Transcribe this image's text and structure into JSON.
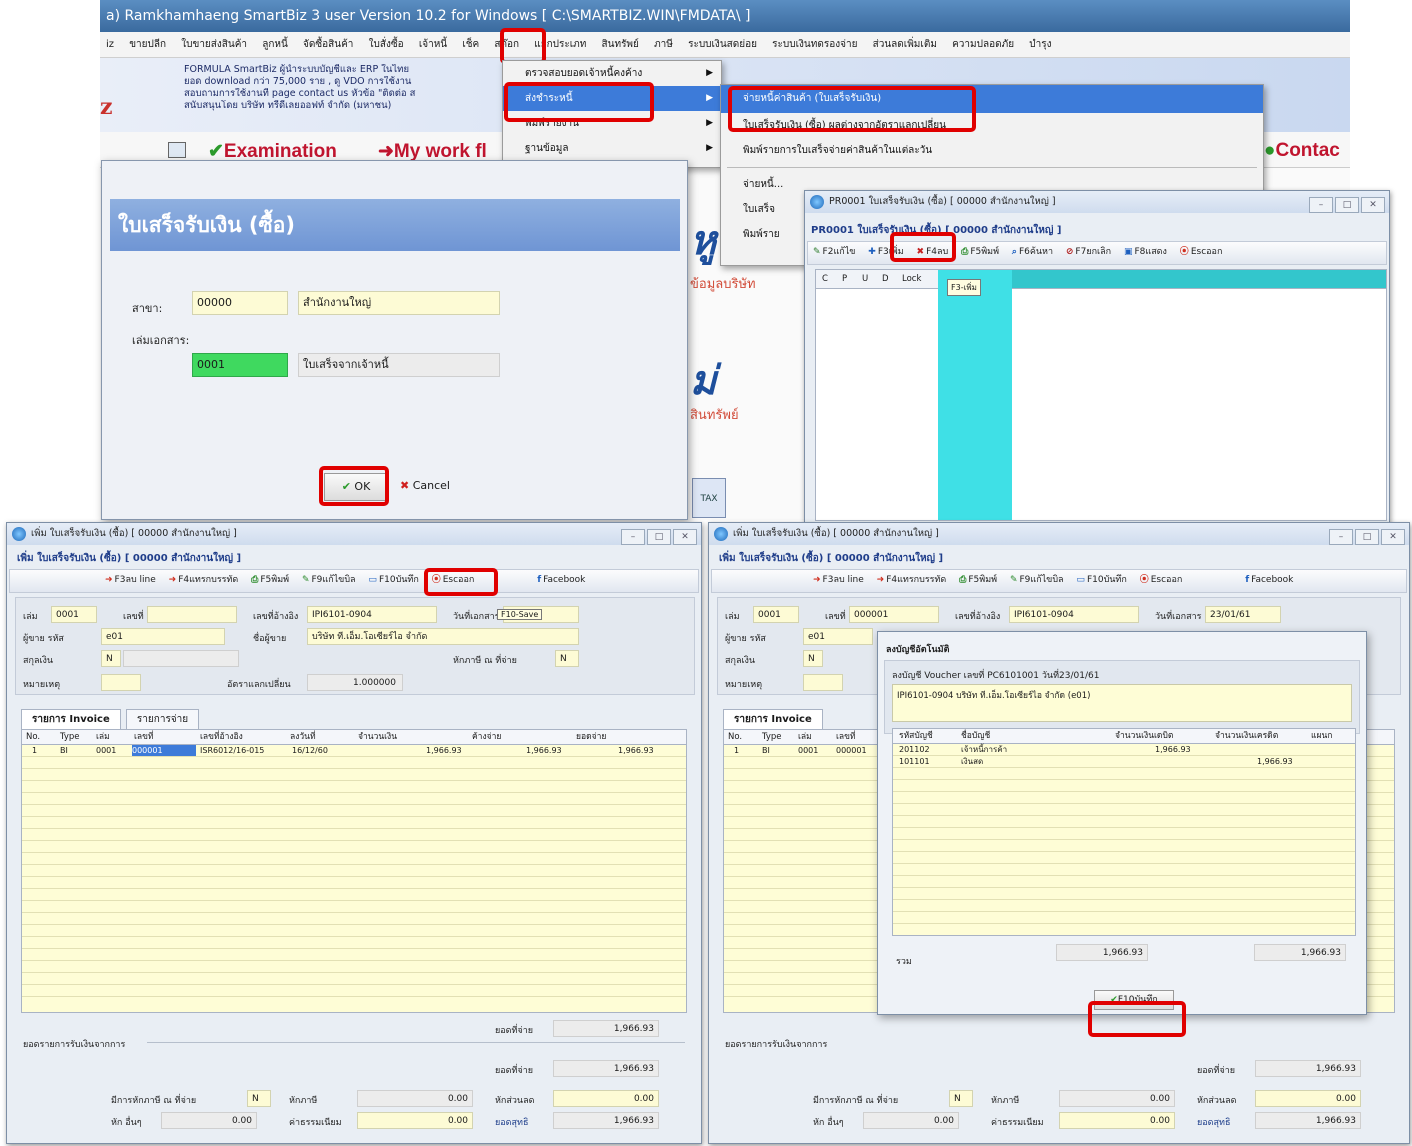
{
  "main_window": {
    "title": "a) Ramkhamhaeng SmartBiz 3 user Version 10.2 for Windows [ C:\\SMARTBIZ.WIN\\FMDATA\\ ]",
    "menu": [
      "iz",
      "ขายปลีก",
      "ใบขายส่งสินค้า",
      "ลูกหนี้",
      "จัดซื้อสินค้า",
      "ใบสั่งซื้อ",
      "เจ้าหนี้",
      "เช็ค",
      "สต๊อก",
      "แยกประเภท",
      "สินทรัพย์",
      "ภาษี",
      "ระบบเงินสดย่อย",
      "ระบบเงินทดรองจ่าย",
      "ส่วนลดเพิ่มเติม",
      "ความปลอดภัย",
      "บำรุง"
    ],
    "banner": {
      "line1": "FORMULA SmartBiz ผู้นำระบบบัญชีและ ERP ในไทย",
      "line2": "ยอด download กว่า 75,000 ราย , ดู VDO การใช้งาน",
      "line3": "สอบถามการใช้งานที่ page contact us หัวข้อ \"ติดต่อ ส",
      "line4": "สนับสนุนโดย บริษัท ทรีดีเลยออฟท์ จำกัด (มหาชน)",
      "logo": "z"
    },
    "toolbar": {
      "examination": "Examination",
      "mywork": "My work fl",
      "contact": "Contac"
    },
    "bg_words": [
      "ข้อมูลบริษัท",
      "สินทรัพย์"
    ]
  },
  "dropdown_menu_1": {
    "items": [
      {
        "label": "ตรวจสอบยอดเจ้าหนี้คงค้าง"
      },
      {
        "label": "ส่งชำระหนี้"
      },
      {
        "label": "พิมพ์รายงาน"
      },
      {
        "label": "ฐานข้อมูล"
      }
    ]
  },
  "dropdown_menu_2": {
    "items": [
      {
        "label": "จ่ายหนี้ค่าสินค้า (ใบเสร็จรับเงิน)"
      },
      {
        "label": "ใบเสร็จรับเงิน (ซื้อ) ผลต่างจากอัตราแลกเปลี่ยน"
      },
      {
        "label": "พิมพ์รายการใบเสร็จจ่ายค่าสินค้าในแต่ละวัน"
      },
      {
        "label": "จ่ายหนี้..."
      },
      {
        "label": "ใบเสร็จ"
      },
      {
        "label": "พิมพ์ราย"
      }
    ]
  },
  "receipt_dialog": {
    "header": "ใบเสร็จรับเงิน (ซื้อ)",
    "branch_label": "สาขา:",
    "branch_code": "00000",
    "branch_name": "สำนักงานใหญ่",
    "book_label": "เล่มเอกสาร:",
    "book_code": "0001",
    "book_name": "ใบเสร็จจากเจ้าหนี้",
    "ok": "OK",
    "cancel": "Cancel"
  },
  "list_window": {
    "title": "PR0001 ใบเสร็จรับเงิน (ซื้อ) [ 00000 สำนักงานใหญ่ ]",
    "subtitle": "PR0001 ใบเสร็จรับเงิน (ซื้อ) [ 00000 สำนักงานใหญ่ ]",
    "toolbar": [
      "F2แก้ไข",
      "F3เพิ่ม",
      "F4ลบ",
      "F5พิมพ์",
      "F6ค้นหา",
      "F7ยกเลิก",
      "F8แสดง",
      "Escออก"
    ],
    "tooltip": "F3-เพิ่ม",
    "columns": [
      "C",
      "P",
      "U",
      "D",
      "Lock"
    ]
  },
  "add_window": {
    "title": "เพิ่ม ใบเสร็จรับเงิน (ซื้อ) [ 00000 สำนักงานใหญ่ ]",
    "subtitle": "เพิ่ม ใบเสร็จรับเงิน (ซื้อ) [ 00000 สำนักงานใหญ่ ]",
    "toolbar": [
      "F3ลบ line",
      "F4แทรกบรรทัด",
      "F5พิมพ์",
      "F9แก้ไขบิล",
      "F10บันทึก",
      "Escออก",
      "Facebook"
    ],
    "tooltip": "F10-Save",
    "fields": {
      "book_label": "เล่ม",
      "book": "0001",
      "no_label": "เลขที่",
      "no": "",
      "ref_label": "เลขที่อ้างอิง",
      "ref": "IPI6101-0904",
      "date_label": "วันที่เอกสาร",
      "date": "",
      "vendor_label": "ผู้ขาย รหัส",
      "vendor_code": "e01",
      "vendor_name_label": "ชื่อผู้ขาย",
      "vendor_name": "บริษัท ที.เอ็ม.โอเซียร์ไอ จำกัด",
      "currency_label": "สกุลเงิน",
      "currency": "N",
      "wht_label": "หักภาษี ณ ที่จ่าย",
      "wht": "N",
      "rate_label": "อัตราแลกเปลี่ยน",
      "rate": "1.000000",
      "remark_label": "หมายเหตุ"
    },
    "tabs": [
      "รายการ Invoice",
      "รายการจ่าย"
    ],
    "grid_headers": [
      "No.",
      "Type",
      "เล่ม",
      "เลขที่",
      "เลขที่อ้างอิง",
      "ลงวันที่",
      "จำนวนเงิน",
      "ค้างจ่าย",
      "ยอดจ่าย"
    ],
    "grid_row": [
      "1",
      "BI",
      "0001",
      "000001",
      "ISR6012/16-015",
      "16/12/60",
      "1,966.93",
      "1,966.93",
      "1,966.93"
    ],
    "total_label": "ยอดที่จ่าย",
    "total": "1,966.93",
    "section_label": "ยอดรายการรับเงินจากการ",
    "sum_label": "ยอดที่จ่าย",
    "sum": "1,966.93",
    "discount_label": "หักส่วนลด",
    "discount": "0.00",
    "wht2_label": "หักภาษี",
    "wht2": "0.00",
    "fee_label": "ค่าธรรมเนียม",
    "fee": "0.00",
    "vat_label": "มีการหักภาษี ณ ที่จ่าย",
    "vat_flag": "N",
    "other_label": "หัก อื่นๆ",
    "other": "0.00",
    "net_label": "ยอดสุทธิ",
    "net": "1,966.93"
  },
  "save_window": {
    "title": "เพิ่ม ใบเสร็จรับเงิน (ซื้อ) [ 00000 สำนักงานใหญ่ ]",
    "subtitle": "เพิ่ม ใบเสร็จรับเงิน (ซื้อ) [ 00000 สำนักงานใหญ่ ]",
    "toolbar": [
      "F3ลบ line",
      "F4แทรกบรรทัด",
      "F5พิมพ์",
      "F9แก้ไขบิล",
      "F10บันทึก",
      "Escออก",
      "Facebook"
    ],
    "fields": {
      "book": "0001",
      "no": "000001",
      "ref": "IPI6101-0904",
      "date": "23/01/61",
      "vendor_code": "e01",
      "currency": "N"
    },
    "journal": {
      "title": "ลงบัญชีอัตโนมัติ",
      "voucher_line": "ลงบัญชี Voucher เลขที่ PC6101001   วันที่23/01/61",
      "desc": "IPI6101-0904 บริษัท ที.เอ็ม.โอเซียร์ไอ จำกัด (e01)",
      "headers": [
        "รหัสบัญชี",
        "ชื่อบัญชี",
        "จำนวนเงินเดบิต",
        "จำนวนเงินเครดิต",
        "แผนก"
      ],
      "rows": [
        [
          "201102",
          "เจ้าหนี้การค้า",
          "1,966.93",
          "",
          ""
        ],
        [
          "101101",
          "เงินสด",
          "",
          "1,966.93",
          ""
        ]
      ],
      "total_label": "รวม",
      "total_debit": "1,966.93",
      "total_credit": "1,966.93",
      "save_btn": "F10บันทึก"
    }
  }
}
